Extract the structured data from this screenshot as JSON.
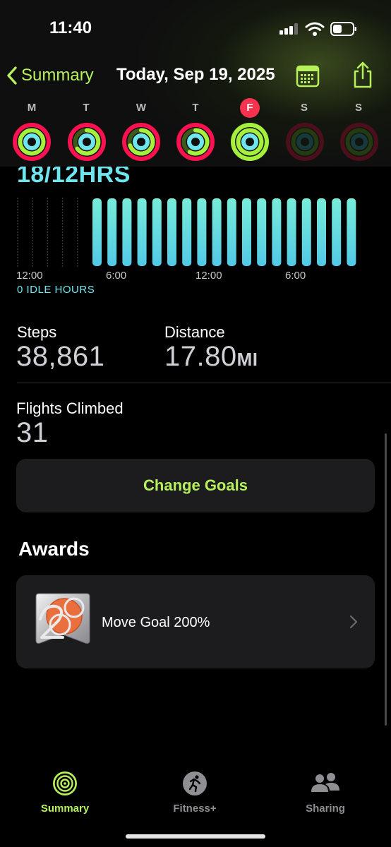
{
  "status": {
    "time": "11:40"
  },
  "nav": {
    "back_label": "Summary",
    "title": "Today, Sep 19, 2025"
  },
  "week": {
    "days": [
      "M",
      "T",
      "W",
      "T",
      "F",
      "S",
      "S"
    ],
    "today_index": 4
  },
  "stand": {
    "summary": "18/12HRS",
    "axis_labels": [
      "12:00",
      "6:00",
      "12:00",
      "6:00"
    ],
    "idle": "0 IDLE HOURS"
  },
  "stats": {
    "steps_label": "Steps",
    "steps_value": "38,861",
    "distance_label": "Distance",
    "distance_value": "17.80",
    "distance_unit": "MI",
    "flights_label": "Flights Climbed",
    "flights_value": "31"
  },
  "goals": {
    "button_label": "Change Goals"
  },
  "awards": {
    "title": "Awards",
    "items": [
      {
        "label": "Move Goal 200%",
        "icon": "move-goal-200-badge"
      }
    ]
  },
  "tabs": [
    {
      "label": "Summary",
      "icon": "summary-rings-icon",
      "active": true
    },
    {
      "label": "Fitness+",
      "icon": "runner-icon",
      "active": false
    },
    {
      "label": "Sharing",
      "icon": "people-icon",
      "active": false
    }
  ],
  "colors": {
    "accent": "#b6f15c",
    "move": "#fa114f",
    "exercise": "#a5f03c",
    "stand": "#6fe6ee",
    "today_badge": "#f7324f",
    "card": "#1c1c1e"
  }
}
